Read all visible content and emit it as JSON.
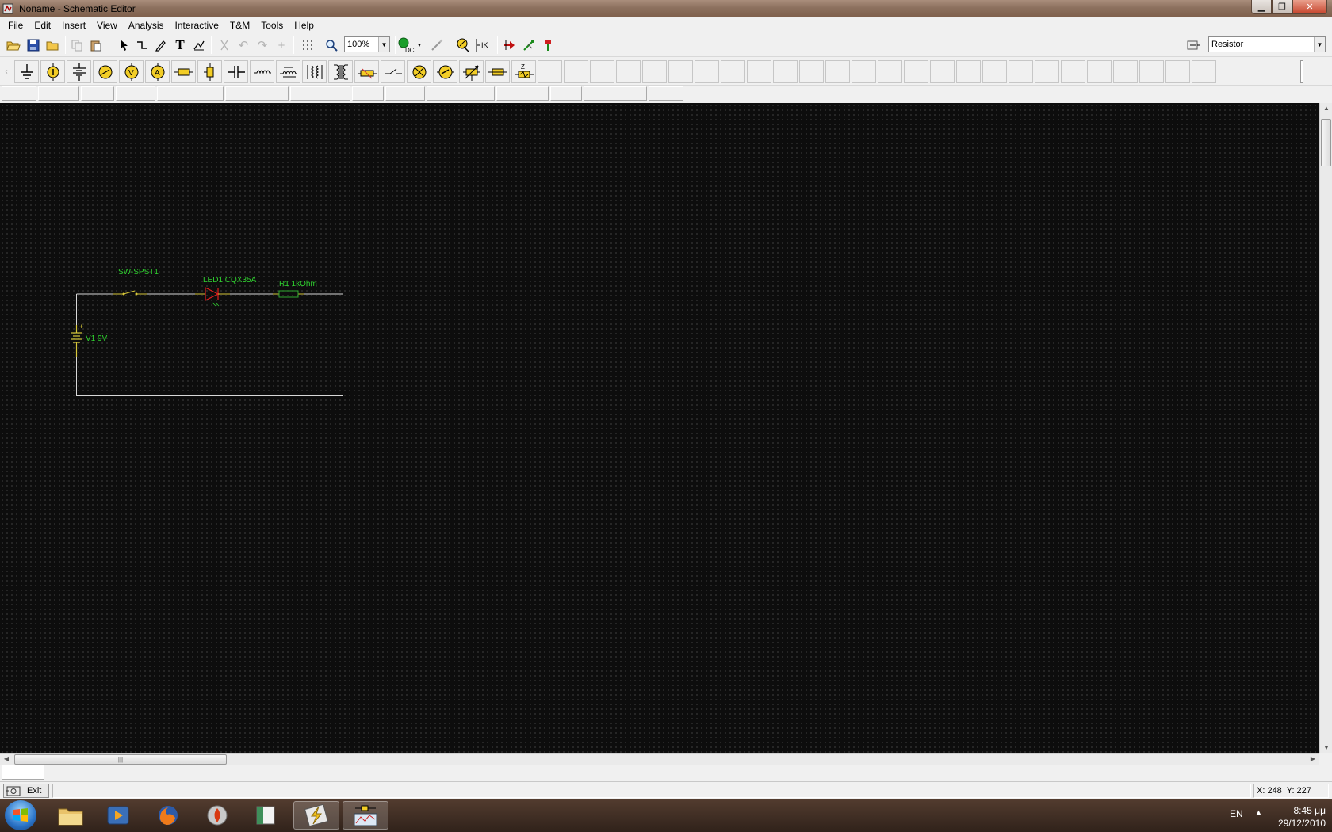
{
  "window": {
    "title": "Noname - Schematic Editor"
  },
  "menu": [
    "File",
    "Edit",
    "Insert",
    "View",
    "Analysis",
    "Interactive",
    "T&M",
    "Tools",
    "Help"
  ],
  "toolbar": {
    "zoom_value": "100%",
    "component_select": "Resistor",
    "dc_label": "DC",
    "probe_label": "IK"
  },
  "schematic": {
    "switch_label": "SW-SPST1",
    "led_label": "LED1 CQX35A",
    "resistor_label": "R1 1kOhm",
    "battery_label": "V1 9V",
    "battery_plus": "+",
    "wire_color": "#d8d8d8",
    "component_color": "#d8c83a",
    "label_color": "#2fd12f",
    "led_color": "#e02020"
  },
  "statusbar": {
    "exit_label": "Exit",
    "coords": "X: 248  Y: 227"
  },
  "taskbar": {
    "language": "EN",
    "time": "8:45 μμ",
    "date": "29/12/2010"
  }
}
